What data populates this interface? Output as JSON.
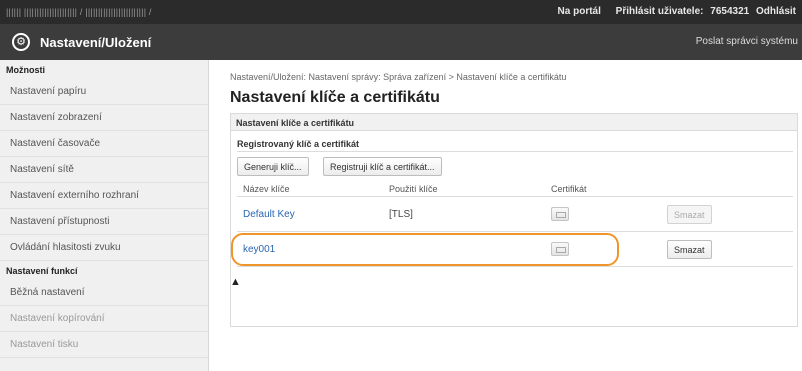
{
  "topbar": {
    "host": "  ||||||     |||||||||||||||||||||  / ||||||||||||||||||||||||  /",
    "portal": "Na portál",
    "logged_label": "Přihlásit uživatele:",
    "user_id": "7654321",
    "logout": "Odhlásit"
  },
  "titlebar": {
    "title": "Nastavení/Uložení",
    "send_mail": "Poslat správci systému"
  },
  "sidebar": {
    "section1": "Možnosti",
    "items": [
      "Nastavení papíru",
      "Nastavení zobrazení",
      "Nastavení časovače",
      "Nastavení sítě",
      "Nastavení externího rozhraní",
      "Nastavení přístupnosti",
      "Ovládání hlasitosti zvuku"
    ],
    "section2": "Nastavení funkcí",
    "items2": [
      "Běžná nastavení",
      "Nastavení kopírování",
      "Nastavení tisku"
    ]
  },
  "main": {
    "breadcrumb": "Nastavení/Uložení: Nastavení správy: Správa zařízení > Nastavení klíče a certifikátu",
    "title": "Nastavení klíče a certifikátu",
    "panel_title": "Nastavení klíče a certifikátu",
    "sub_title": "Registrovaný klíč a certifikát",
    "btn_generate": "Generuji klíč...",
    "btn_register": "Registruji klíč a certifikát...",
    "col_name": "Název klíče",
    "col_use": "Použití klíče",
    "col_cert": "Certifikát",
    "rows": [
      {
        "name": "Default Key",
        "use": "[TLS]",
        "delete": "Smazat",
        "delete_enabled": false
      },
      {
        "name": "key001",
        "use": "",
        "delete": "Smazat",
        "delete_enabled": true
      }
    ],
    "top_link": "▲"
  },
  "colors": {
    "accent_highlight": "#f0952a",
    "link": "#2a66b0",
    "titlebar": "#3c3c3c"
  }
}
